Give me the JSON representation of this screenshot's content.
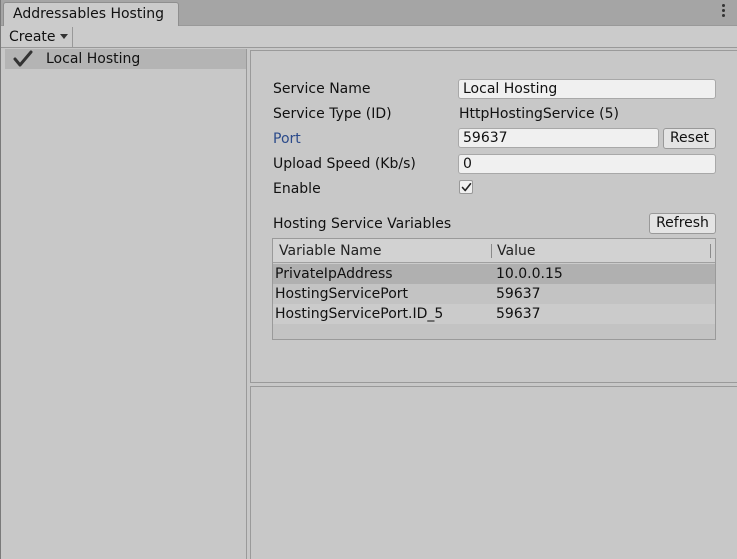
{
  "window": {
    "tab_title": "Addressables Hosting"
  },
  "toolbar": {
    "create_label": "Create"
  },
  "services_list": {
    "items": [
      {
        "label": "Local Hosting",
        "enabled": true
      }
    ]
  },
  "service": {
    "name_label": "Service Name",
    "name_value": "Local Hosting",
    "type_label": "Service Type (ID)",
    "type_value": "HttpHostingService (5)",
    "port_label": "Port",
    "port_value": "59637",
    "reset_label": "Reset",
    "upload_label": "Upload Speed (Kb/s)",
    "upload_value": "0",
    "enable_label": "Enable",
    "enable_checked": true
  },
  "variables": {
    "title": "Hosting Service Variables",
    "refresh_label": "Refresh",
    "columns": [
      "Variable Name",
      "Value"
    ],
    "rows": [
      {
        "name": "PrivateIpAddress",
        "value": "10.0.0.15"
      },
      {
        "name": "HostingServicePort",
        "value": "59637"
      },
      {
        "name": "HostingServicePort.ID_5",
        "value": "59637"
      }
    ]
  },
  "colors": {
    "port_label": "#2b4a8a",
    "selected_row": "#b0b0b0",
    "panel_bg": "#c8c8c8"
  }
}
